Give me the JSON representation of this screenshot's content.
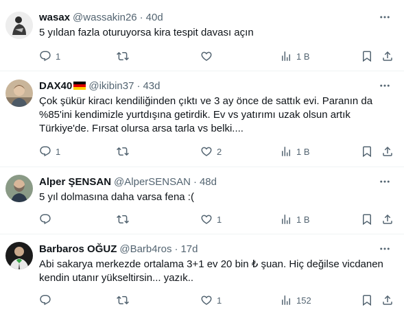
{
  "tweets": [
    {
      "name": "wasax",
      "handle": "@wassakin26",
      "time": "40d",
      "text": "5 yıldan fazla oturuyorsa kira tespit davası açın",
      "replies": "1",
      "retweets": "",
      "likes": "",
      "views": "1 B"
    },
    {
      "name": "DAX40",
      "handle": "@ikibin37",
      "time": "43d",
      "text": "Çok şükür kiracı kendiliğinden çıktı ve 3 ay önce de sattık evi. Paranın da %85'ini kendimizle yurtdışına getirdik. Ev vs yatırımı uzak olsun artık Türkiye'de. Fırsat olursa arsa tarla vs belki....",
      "replies": "1",
      "retweets": "",
      "likes": "2",
      "views": "1 B"
    },
    {
      "name": "Alper ŞENSAN",
      "handle": "@AlperSENSAN",
      "time": "48d",
      "text": "5 yıl dolmasına daha varsa fena :(",
      "replies": "",
      "retweets": "",
      "likes": "1",
      "views": "1 B"
    },
    {
      "name": "Barbaros OĞUZ",
      "handle": "@Barb4ros",
      "time": "17d",
      "text": "Abi sakarya merkezde ortalama 3+1 ev 20 bin ₺ şuan. Hiç değilse vicdanen kendin utanır yükseltirsin... yazık..",
      "replies": "",
      "retweets": "",
      "likes": "1",
      "views": "152"
    }
  ],
  "separator": "·",
  "icons": {
    "reply": "reply-icon",
    "retweet": "retweet-icon",
    "like": "heart-icon",
    "views": "views-icon",
    "bookmark": "bookmark-icon",
    "share": "share-icon",
    "more": "more-icon"
  }
}
